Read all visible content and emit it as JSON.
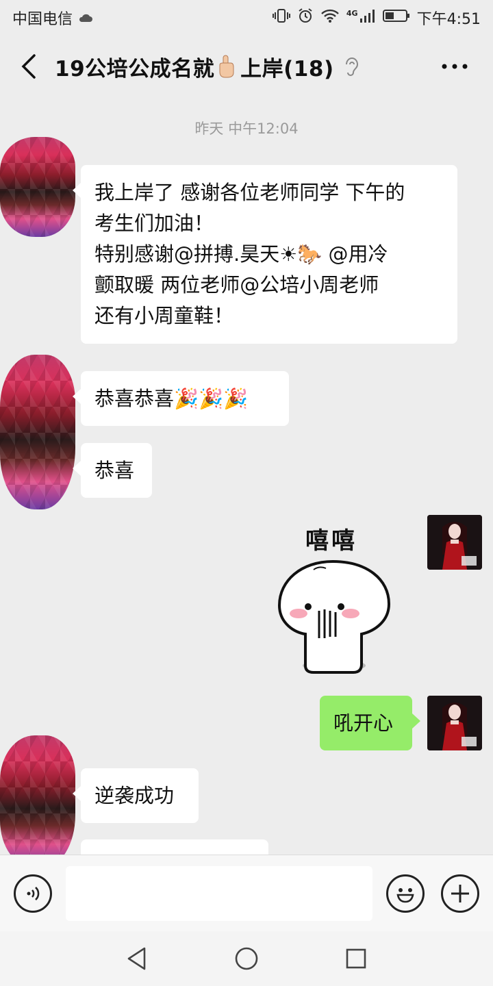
{
  "status_bar": {
    "carrier": "中国电信",
    "network": "4G",
    "time": "下午4:51"
  },
  "header": {
    "title_prefix": "19公培公成名就",
    "title_suffix": "上岸(18)"
  },
  "chat": {
    "timestamp": "昨天 中午12:04",
    "messages": [
      {
        "sender": "other",
        "lines": [
          "我上岸了 感谢各位老师同学 下午的",
          "考生们加油！",
          "特别感谢@拼搏.昊天☀🐎 @用冷",
          "颤取暖  两位老师@公培小周老师",
          "还有小周童鞋！"
        ]
      },
      {
        "sender": "other",
        "text": "恭喜恭喜🎉🎉🎉"
      },
      {
        "sender": "other",
        "text": "恭喜"
      },
      {
        "sender": "me",
        "sticker_text": "嘻嘻"
      },
      {
        "sender": "me",
        "text": "吼开心"
      },
      {
        "sender": "other",
        "text": "逆袭成功"
      }
    ]
  },
  "input": {
    "value": ""
  },
  "colors": {
    "background": "#ededed",
    "my_bubble": "#95ec69",
    "other_bubble": "#ffffff"
  }
}
